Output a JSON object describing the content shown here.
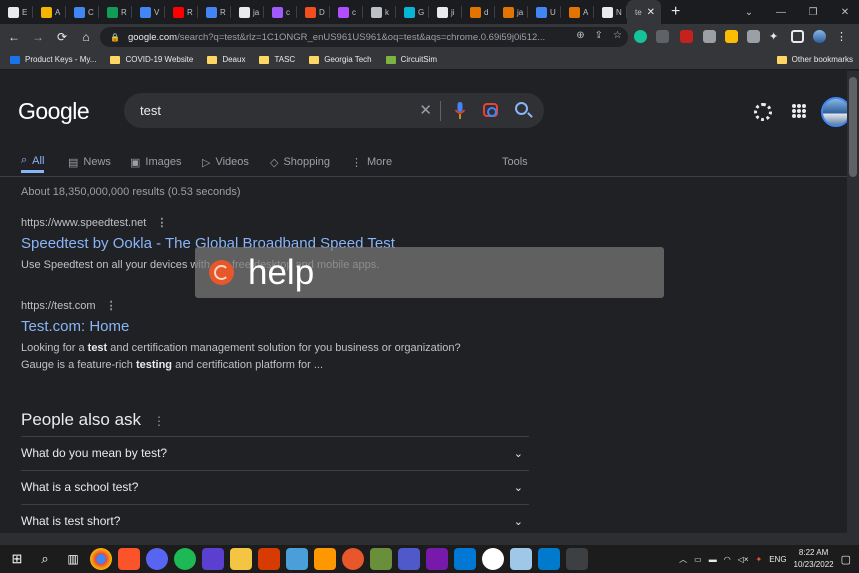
{
  "tabs": [
    {
      "letter": "E",
      "color": "#e8eaed"
    },
    {
      "letter": "A",
      "color": "#f4b400"
    },
    {
      "letter": "C",
      "color": "#4285f4"
    },
    {
      "letter": "R",
      "color": "#0f9d58"
    },
    {
      "letter": "V",
      "color": "#4285f4"
    },
    {
      "letter": "R",
      "color": "#ff0000"
    },
    {
      "letter": "R",
      "color": "#4285f4"
    },
    {
      "letter": "ja",
      "color": "#e8eaed"
    },
    {
      "letter": "c",
      "color": "#a259ff"
    },
    {
      "letter": "D",
      "color": "#f24e1e"
    },
    {
      "letter": "c",
      "color": "#b44dff"
    },
    {
      "letter": "k",
      "color": "#bdc1c6"
    },
    {
      "letter": "G",
      "color": "#06b6d4"
    },
    {
      "letter": "ji",
      "color": "#e8eaed"
    },
    {
      "letter": "d",
      "color": "#e37400"
    },
    {
      "letter": "ja",
      "color": "#e37400"
    },
    {
      "letter": "U",
      "color": "#4285f4"
    },
    {
      "letter": "A",
      "color": "#e37400"
    },
    {
      "letter": "N",
      "color": "#e8eaed"
    }
  ],
  "active_tab": {
    "label": "te",
    "close": "✕"
  },
  "new_tab": "+",
  "window": {
    "minimize": "⌄",
    "min": "—",
    "max": "❐",
    "close": "✕"
  },
  "address": {
    "domain": "google.com",
    "path": "/search?q=test&rlz=1C1ONGR_enUS961US961&oq=test&aqs=chrome.0.69i59j0i512..."
  },
  "bookmarks": [
    {
      "label": "Product Keys - My...",
      "icon": "blue-square"
    },
    {
      "label": "COVID-19 Website",
      "icon": "folder"
    },
    {
      "label": "Deaux",
      "icon": "folder"
    },
    {
      "label": "TASC",
      "icon": "folder"
    },
    {
      "label": "Georgia Tech",
      "icon": "folder"
    },
    {
      "label": "CircuitSim",
      "icon": "vmc"
    }
  ],
  "other_bookmarks": "Other bookmarks",
  "logo": "Google",
  "search": {
    "query": "test"
  },
  "nav_tabs": [
    {
      "label": "All",
      "icon": "search-icon"
    },
    {
      "label": "News",
      "icon": "news-icon"
    },
    {
      "label": "Images",
      "icon": "images-icon"
    },
    {
      "label": "Videos",
      "icon": "videos-icon"
    },
    {
      "label": "Shopping",
      "icon": "shopping-icon"
    },
    {
      "label": "More",
      "icon": "more-icon"
    }
  ],
  "tools": "Tools",
  "stats": "About 18,350,000,000 results (0.53 seconds)",
  "results": [
    {
      "url": "https://www.speedtest.net",
      "title": "Speedtest by Ookla - The Global Broadband Speed Test",
      "snippet": "Use Speedtest on all your devices with our free desktop and mobile apps."
    },
    {
      "url": "https://test.com",
      "title": "Test.com: Home",
      "snippet_pre": "Looking for a ",
      "snippet_bold": "test",
      "snippet_post": " and certification management solution for you business or organization?",
      "snippet2_pre": "Gauge is a feature-rich ",
      "snippet2_bold": "testing",
      "snippet2_post": " and certification platform for ..."
    }
  ],
  "paa_title": "People also ask",
  "questions": [
    "What do you mean by test?",
    "What is a school test?",
    "What is test short?"
  ],
  "overlay_text": "help",
  "tray": {
    "lang": "ENG",
    "time": "8:22 AM",
    "date": "10/23/2022"
  }
}
